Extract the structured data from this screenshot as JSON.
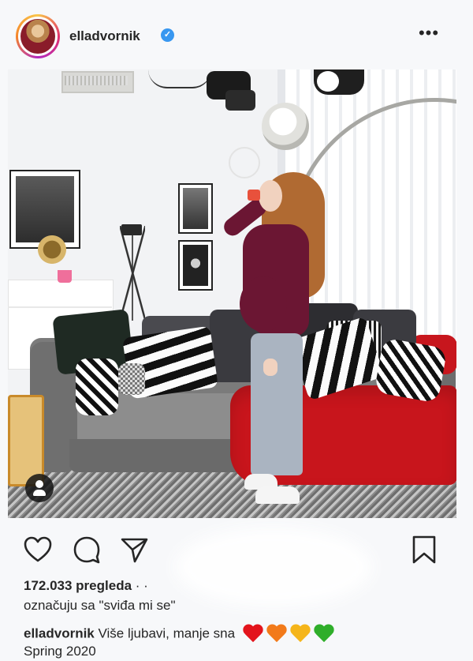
{
  "post": {
    "username": "elladvornik",
    "verified": true,
    "more_label": "•••",
    "views_text": "172.033 pregleda",
    "views_suffix": " · ·",
    "likes_text": "označuju sa \"sviđa mi se\"",
    "caption_user": "elladvornik",
    "caption_text": "Više ljubavi, manje sna",
    "caption_line2": "Spring 2020",
    "hearts": [
      {
        "color": "#e3141c",
        "name": "red-heart-icon"
      },
      {
        "color": "#f27a1a",
        "name": "orange-heart-icon"
      },
      {
        "color": "#f5b51a",
        "name": "yellow-heart-icon"
      },
      {
        "color": "#2fae2a",
        "name": "green-heart-icon"
      }
    ]
  },
  "actions": {
    "icons": [
      "heart-outline-icon",
      "comment-icon",
      "share-icon",
      "bookmark-icon"
    ]
  },
  "colors": {
    "verified_blue": "#3897f0",
    "text": "#262626",
    "background": "#f7f8fa"
  }
}
